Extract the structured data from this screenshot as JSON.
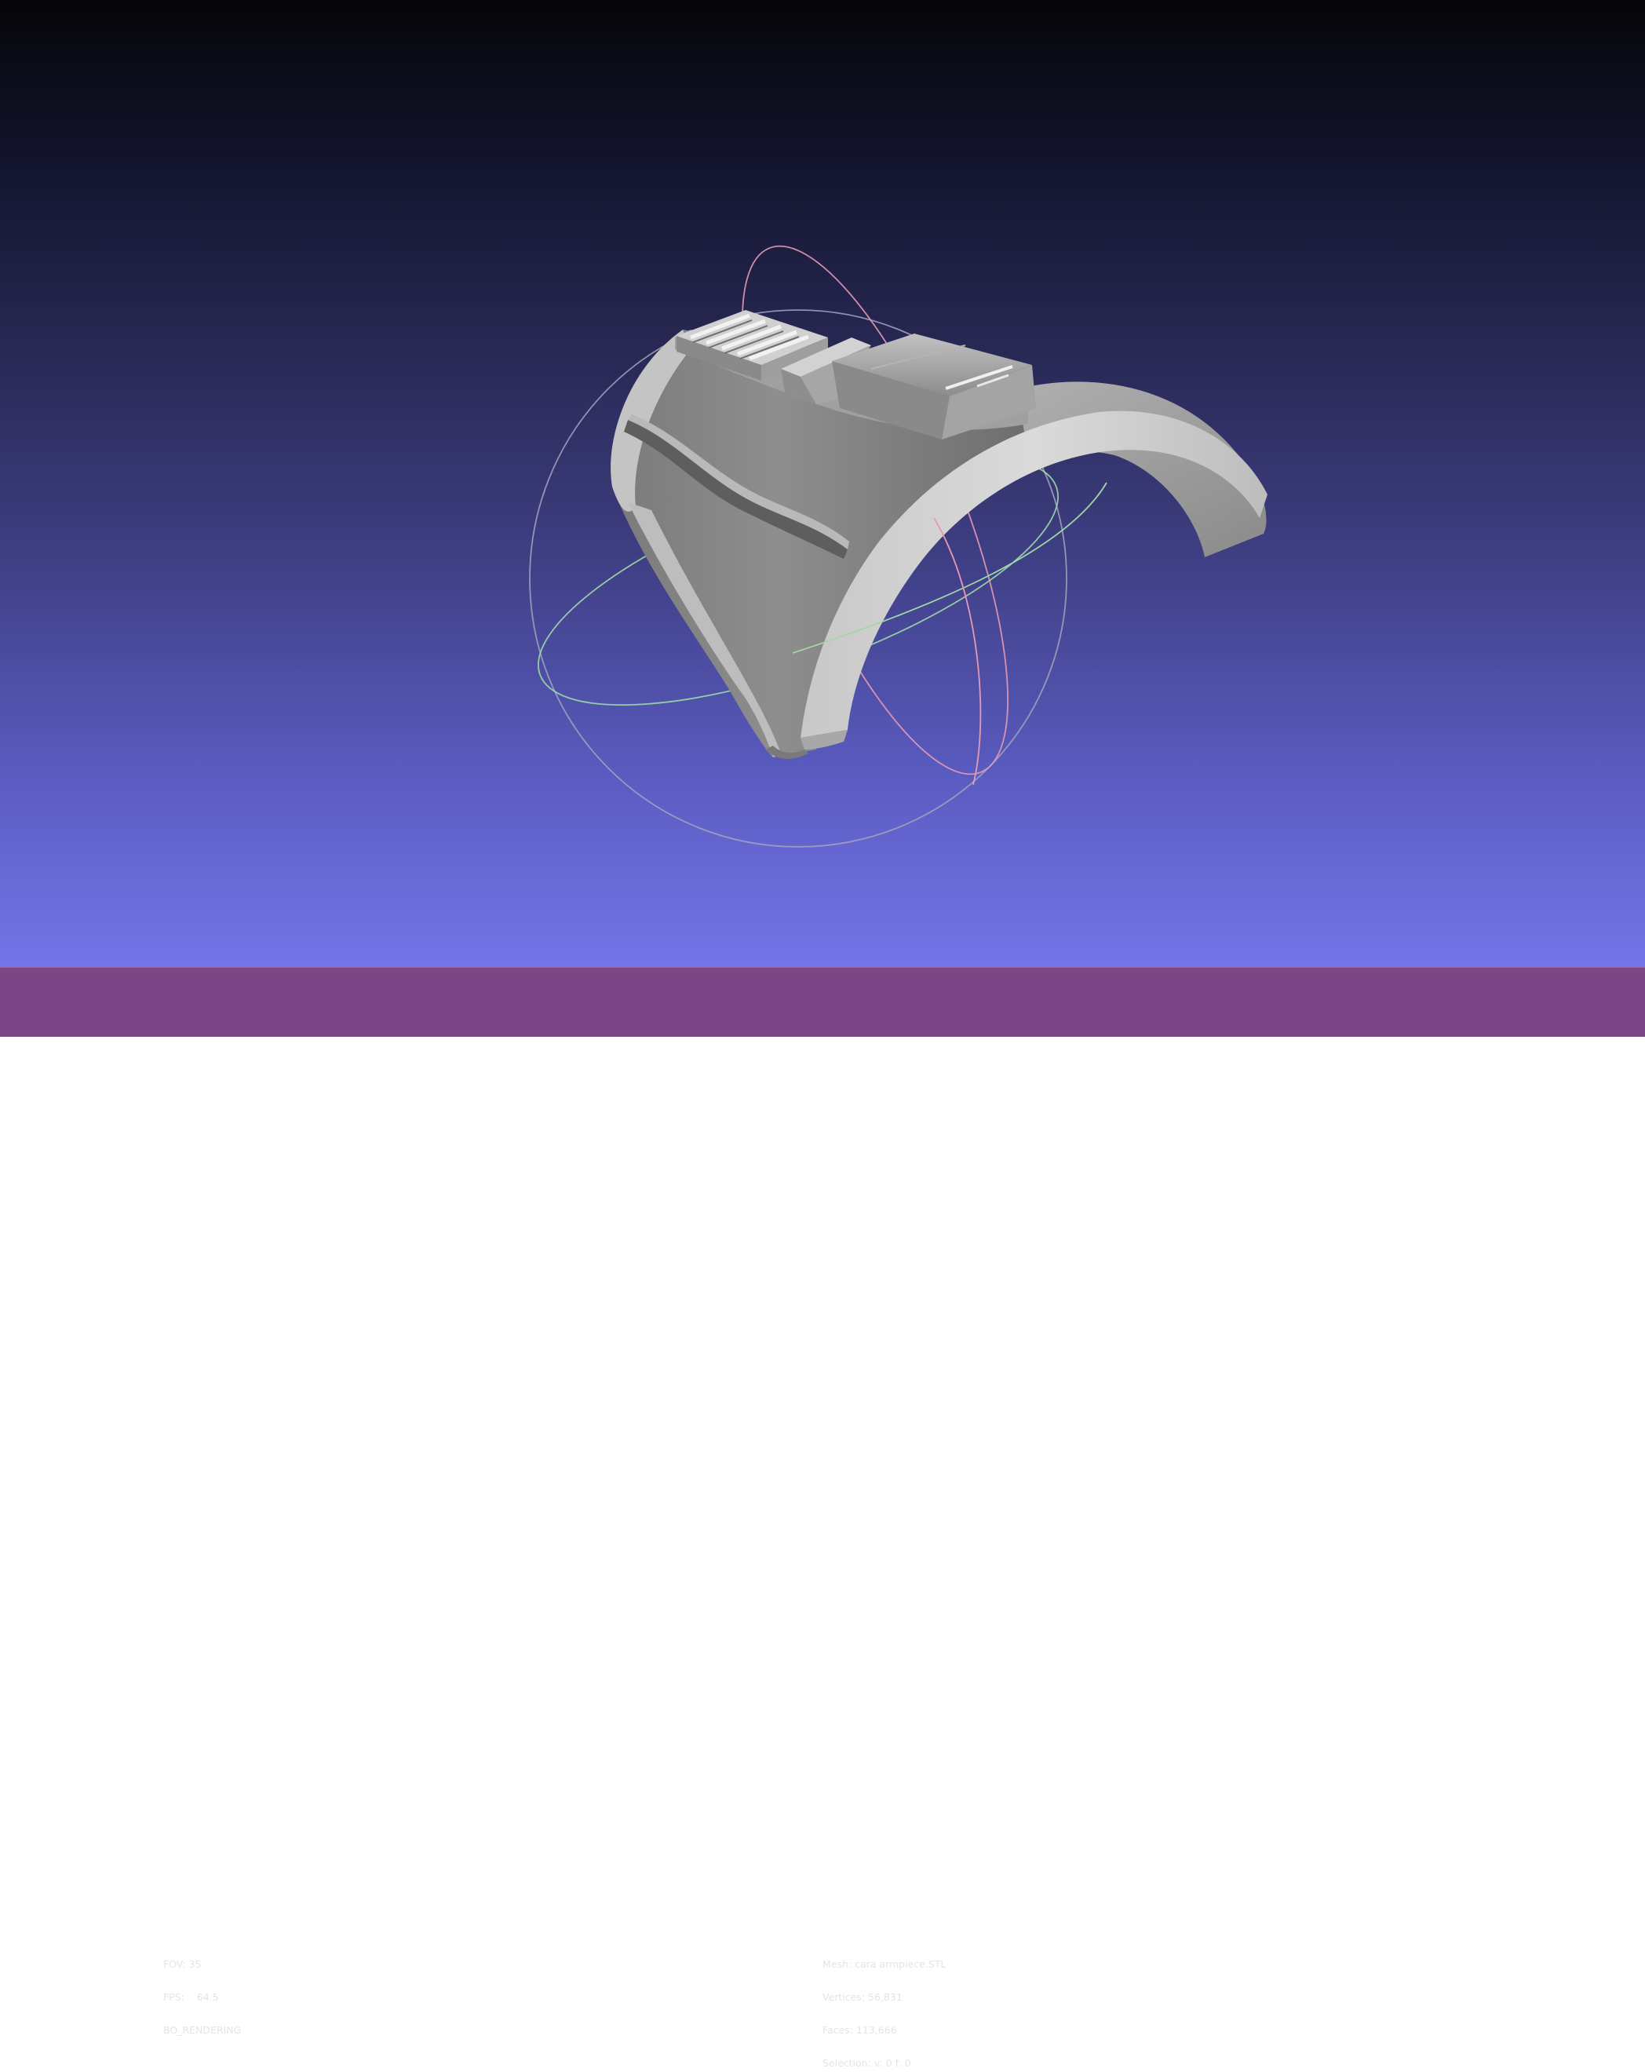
{
  "viewer": {
    "left_info": {
      "fov": "FOV: 35",
      "fps": "FPS:    64.5",
      "render_mode": "BO_RENDERING"
    },
    "mesh_info": {
      "mesh": "Mesh: cara armpiece.STL",
      "vertices": "Vertices: 56,831",
      "faces": "Faces: 113,666",
      "selection": "Selection: v: 0 f: 0"
    }
  },
  "colors": {
    "statusbar": "#7c4585",
    "mesh": "#9a9a9a",
    "trackball_x": "#e59ab4",
    "trackball_y": "#9ed8a8",
    "trackball_z": "#b0b0c8"
  }
}
